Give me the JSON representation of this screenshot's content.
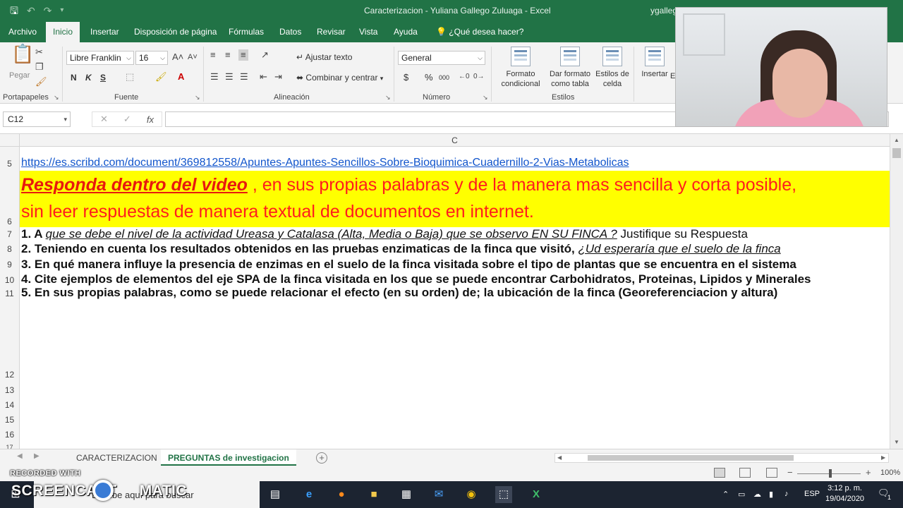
{
  "window": {
    "title": "Caracterizacion - Yuliana Gallego Zuluaga  -  Excel",
    "user": "ygalleg"
  },
  "ribbon_tabs": [
    "Archivo",
    "Inicio",
    "Insertar",
    "Disposición de página",
    "Fórmulas",
    "Datos",
    "Revisar",
    "Vista",
    "Ayuda",
    "¿Qué desea hacer?"
  ],
  "ribbon": {
    "clipboard": {
      "paste": "Pegar",
      "label": "Portapapeles"
    },
    "font": {
      "name": "Libre Franklin",
      "size": "16",
      "bold": "N",
      "italic": "K",
      "underline": "S",
      "label": "Fuente"
    },
    "alignment": {
      "wrap": "Ajustar texto",
      "merge": "Combinar y centrar",
      "label": "Alineación"
    },
    "number": {
      "format": "General",
      "currency": "$",
      "percent": "%",
      "thousands": "000",
      "label": "Número"
    },
    "styles": {
      "conditional": "Formato condicional",
      "table": "Dar formato como tabla",
      "cell": "Estilos de celda",
      "label": "Estilos"
    },
    "cells": {
      "insert": "Insertar",
      "insert_extra": "E"
    }
  },
  "formula_bar": {
    "name_box": "C12",
    "fx": "fx",
    "value": ""
  },
  "grid": {
    "column_header": "C",
    "rows": [
      "5",
      "6",
      "7",
      "8",
      "9",
      "10",
      "11",
      "12",
      "13",
      "14",
      "15",
      "16",
      "17"
    ],
    "link": "https://es.scribd.com/document/369812558/Apuntes-Apuntes-Sencillos-Sobre-Bioquimica-Cuadernillo-2-Vias-Metabolicas",
    "instruction_emph": "Responda dentro del video",
    "instruction_rest": " , en sus propias palabras y de la manera mas sencilla y corta posible,",
    "instruction_line2": "sin leer respuestas de manera textual de documentos en internet.",
    "q1_a": "1. A ",
    "q1_b": "que se debe el nivel de la actividad Ureasa y Catalasa (Alta, Media o Baja) que se observo EN SU FINCA ?",
    "q1_c": "  Justifique su Respuesta",
    "q2_a": "2. Teniendo en cuenta los resultados obtenidos en las pruebas enzimaticas de la finca que visitó, ",
    "q2_b": "¿Ud esperaría que el suelo de la finca",
    "q3": "3. En qué manera influye la presencia de enzimas en el suelo de la finca visitada sobre el tipo de plantas que se encuentra en el sistema",
    "q4": "4. Cite ejemplos de elementos del eje SPA de la finca visitada en los que se puede encontrar Carbohidratos, Proteinas, Lipidos y Minerales",
    "q5": "5. En sus propias palabras, como se puede relacionar el efecto (en su orden) de; la ubicación de la finca (Georeferenciacion y altura)"
  },
  "sheets": {
    "tab1": "CARACTERIZACION",
    "tab2": "PREGUNTAS de investigacion"
  },
  "status": {
    "zoom": "100%"
  },
  "overlay": {
    "recorded": "RECORDED WITH",
    "screencast": "SCREENCAST",
    "matic": "MATIC"
  },
  "taskbar": {
    "search_placeholder": "Escribe aquí para buscar",
    "language": "ESP",
    "time": "3:12 p. m.",
    "date": "19/04/2020",
    "notifications": "1"
  },
  "colors": {
    "excel_green": "#217346",
    "highlight": "#ffff00",
    "instruction_red": "#ff1d1d",
    "link": "#1155cc"
  }
}
